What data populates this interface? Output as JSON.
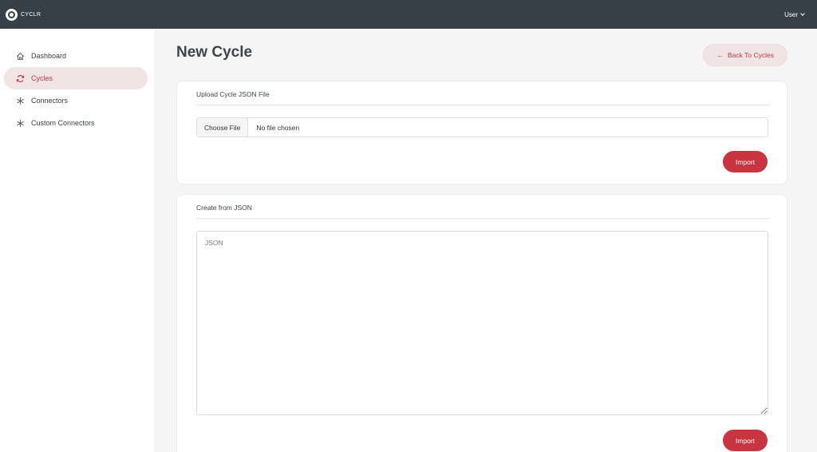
{
  "app": {
    "logo_text": "CYCLR"
  },
  "header": {
    "user_label": "User"
  },
  "sidebar": {
    "items": [
      {
        "label": "Dashboard",
        "icon": "home-icon",
        "active": false
      },
      {
        "label": "Cycles",
        "icon": "cycle-icon",
        "active": true
      },
      {
        "label": "Connectors",
        "icon": "asterisk-icon",
        "active": false
      },
      {
        "label": "Custom Connectors",
        "icon": "asterisk-icon",
        "active": false
      }
    ]
  },
  "main": {
    "title": "New Cycle",
    "back_label": "Back To Cycles",
    "upload": {
      "title": "Upload Cycle JSON File",
      "choose_label": "Choose File",
      "file_status": "No file chosen",
      "import_label": "Import"
    },
    "create": {
      "title": "Create from JSON",
      "placeholder": "JSON",
      "import_label": "Import"
    }
  },
  "colors": {
    "topbar": "#374047",
    "accent": "#c83440",
    "active_bg": "#f1e4e5"
  }
}
